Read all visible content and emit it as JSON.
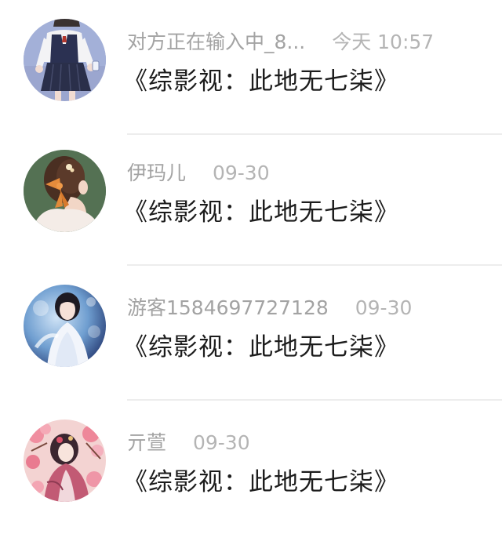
{
  "conversations": [
    {
      "name": "对方正在输入中_8...",
      "time": "今天 10:57",
      "message": "《综影视：此地无七柒》",
      "avatar_icon": "schoolgirl-avatar-icon"
    },
    {
      "name": "伊玛儿",
      "time": "09-30",
      "message": "《综影视：此地无七柒》",
      "avatar_icon": "girl-with-bow-avatar-icon"
    },
    {
      "name": "游客1584697727128",
      "time": "09-30",
      "message": "《综影视：此地无七柒》",
      "avatar_icon": "woman-in-white-avatar-icon"
    },
    {
      "name": "亓萱",
      "time": "09-30",
      "message": "《综影视：此地无七柒》",
      "avatar_icon": "floral-illustration-avatar-icon"
    }
  ]
}
